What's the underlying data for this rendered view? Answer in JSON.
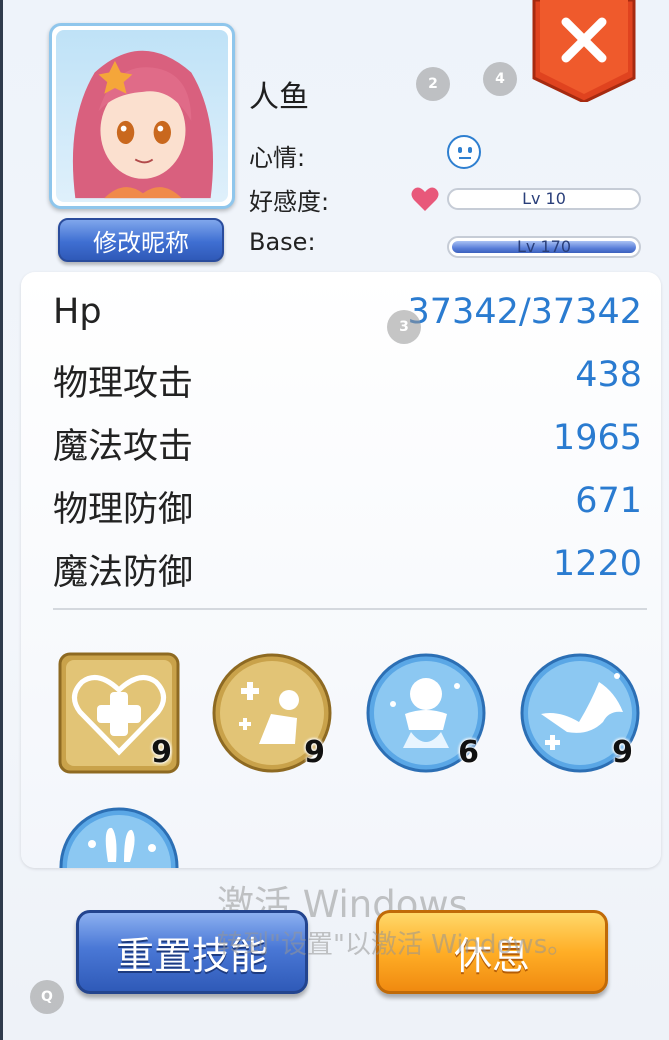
{
  "profile": {
    "name": "人鱼",
    "rename_label": "修改昵称",
    "mood_label": "心情:",
    "favor_label": "好感度:",
    "base_label": "Base:",
    "favor_level": "Lv 10",
    "favor_progress": 0.0,
    "base_level": "Lv 170",
    "base_progress": 1.0
  },
  "badges": [
    "2",
    "4",
    "3",
    "Q"
  ],
  "stats": [
    {
      "label": "Hp",
      "value": "37342/37342"
    },
    {
      "label": "物理攻击",
      "value": "438"
    },
    {
      "label": "魔法攻击",
      "value": "1965"
    },
    {
      "label": "物理防御",
      "value": "671"
    },
    {
      "label": "魔法防御",
      "value": "1220"
    }
  ],
  "skills": [
    {
      "icon": "heart-cross-icon",
      "level": "9"
    },
    {
      "icon": "heal-sparkle-icon",
      "level": "9"
    },
    {
      "icon": "mermaid-spirit-icon",
      "level": "6"
    },
    {
      "icon": "whale-tail-icon",
      "level": "9"
    },
    {
      "icon": "bunny-icon",
      "level": ""
    }
  ],
  "buttons": {
    "reset_skills": "重置技能",
    "rest": "休息"
  },
  "watermark": {
    "line1": "激活 Windows",
    "line2": "转到\"设置\"以激活 Windows。"
  },
  "colors": {
    "stat_value": "#2a7bd0",
    "close_red": "#e0431f",
    "reset_blue": "#3f6fd2",
    "rest_orange": "#ffae26"
  }
}
